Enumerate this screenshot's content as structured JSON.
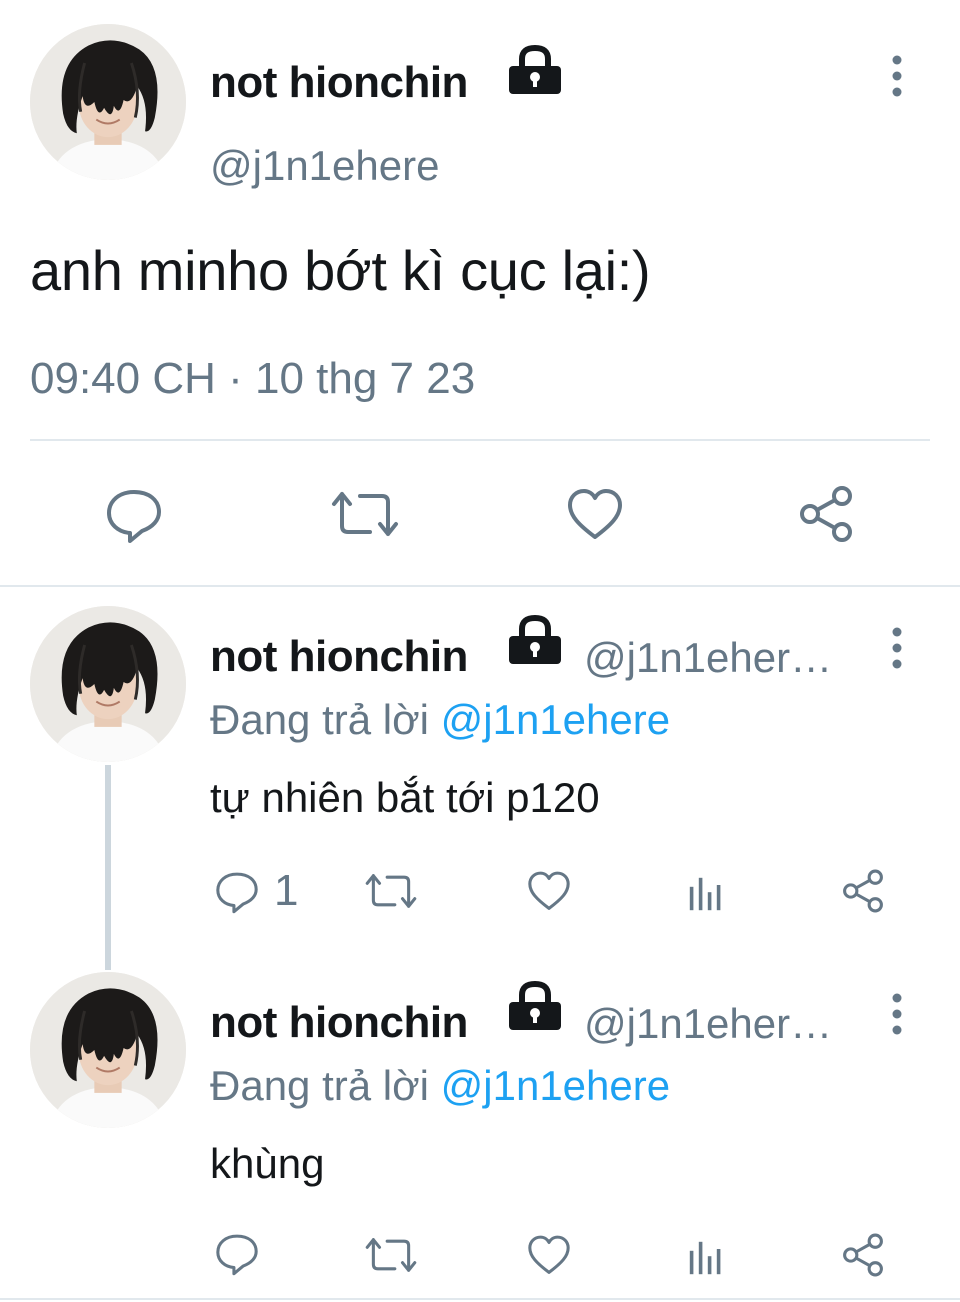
{
  "main_tweet": {
    "display_name": "not hionchin",
    "handle": "@j1n1ehere",
    "text": "anh minho bớt kì cục lại:)",
    "timestamp": "09:40 CH · 10 thg 7 23",
    "actions": [
      "reply-icon",
      "retweet-icon",
      "like-icon",
      "share-icon"
    ]
  },
  "replies": [
    {
      "display_name": "not hionchin",
      "handle": "@j1n1eher…",
      "replying_prefix": "Đang trả lời",
      "replying_to": "@j1n1ehere",
      "text": "tự nhiên bắt tới p120",
      "reply_count": "1"
    },
    {
      "display_name": "not hionchin",
      "handle": "@j1n1eher…",
      "replying_prefix": "Đang trả lời",
      "replying_to": "@j1n1ehere",
      "text": "khùng",
      "reply_count": ""
    }
  ],
  "colors": {
    "text": "#14171a",
    "secondary": "#657786",
    "link": "#1da1f2",
    "divider": "#e1e8ed"
  }
}
